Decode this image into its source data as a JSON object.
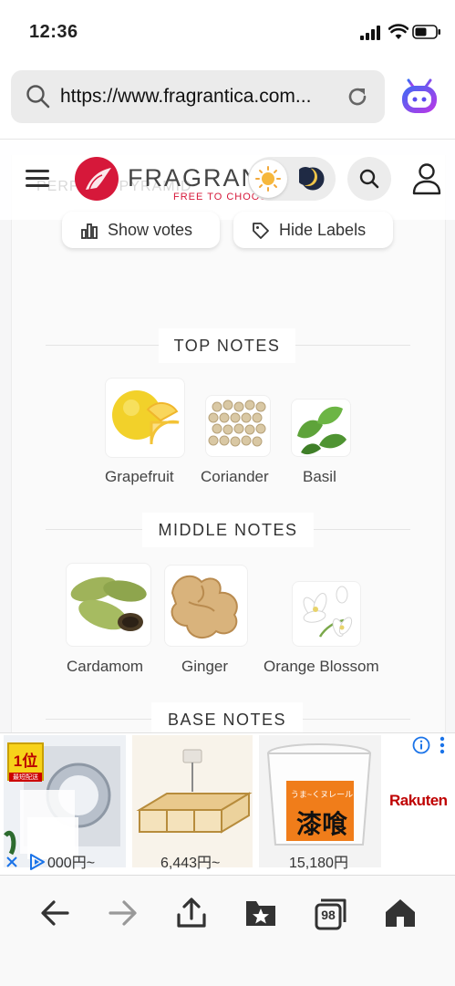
{
  "status": {
    "time": "12:36"
  },
  "browser": {
    "url": "https://www.fragrantica.com..."
  },
  "header": {
    "logo_text": "FRAGRANTICA",
    "tagline": "FREE TO CHOOSE",
    "ghost_text": "PERFUME PYRAMID"
  },
  "controls": {
    "show_votes": "Show votes",
    "hide_labels": "Hide Labels"
  },
  "pyramid": {
    "top": {
      "title": "TOP NOTES",
      "notes": [
        "Grapefruit",
        "Coriander",
        "Basil"
      ]
    },
    "middle": {
      "title": "MIDDLE NOTES",
      "notes": [
        "Cardamom",
        "Ginger",
        "Orange Blossom"
      ]
    },
    "base": {
      "title": "BASE NOTES"
    }
  },
  "ad": {
    "prices": [
      "000円~",
      "6,443円~",
      "15,180円"
    ],
    "brand": "Rakuten",
    "badge": "1位",
    "badge_sub": "最短配送",
    "paint_text_1": "うま~くヌレール",
    "paint_text_2": "漆喰"
  },
  "toolbar": {
    "tabs_count": "98"
  },
  "colors": {
    "accent": "#d6183a",
    "ad_brand": "#bf0000",
    "bot": "#7b3fe4"
  }
}
